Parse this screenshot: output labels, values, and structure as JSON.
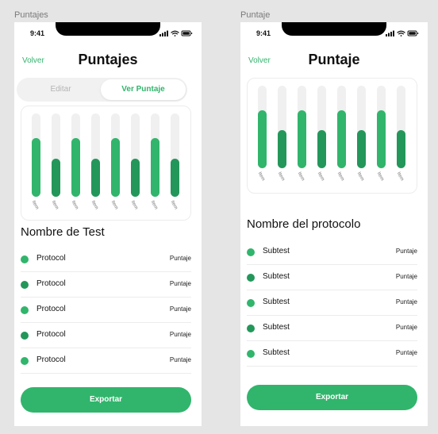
{
  "colors": {
    "accent": "#31b56c",
    "accent_dark": "#23975a",
    "track": "#f0f0f0",
    "canvas": "#e5e5e5"
  },
  "screens": [
    {
      "frame_label": "Puntajes",
      "status_time": "9:41",
      "nav": {
        "back_label": "Volver",
        "title": "Puntajes"
      },
      "segmented": {
        "options": [
          "Editar",
          "Ver Puntaje"
        ],
        "selected": "Ver Puntaje"
      },
      "chart_data": {
        "type": "bar",
        "categories": [
          "Item",
          "Item",
          "Item",
          "Item",
          "Item",
          "Item",
          "Item",
          "Item"
        ],
        "values": [
          0.7,
          0.46,
          0.7,
          0.46,
          0.7,
          0.46,
          0.7,
          0.46
        ],
        "ylim": [
          0,
          1
        ]
      },
      "section_title": "Nombre de Test",
      "rows": [
        {
          "name": "Protocol",
          "score": "Puntaje"
        },
        {
          "name": "Protocol",
          "score": "Puntaje"
        },
        {
          "name": "Protocol",
          "score": "Puntaje"
        },
        {
          "name": "Protocol",
          "score": "Puntaje"
        },
        {
          "name": "Protocol",
          "score": "Puntaje"
        }
      ],
      "export_label": "Exportar"
    },
    {
      "frame_label": "Puntaje",
      "status_time": "9:41",
      "nav": {
        "back_label": "Volver",
        "title": "Puntaje"
      },
      "chart_data": {
        "type": "bar",
        "categories": [
          "Item",
          "Item",
          "Item",
          "Item",
          "Item",
          "Item",
          "Item",
          "Item"
        ],
        "values": [
          0.7,
          0.46,
          0.7,
          0.46,
          0.7,
          0.46,
          0.7,
          0.46
        ],
        "ylim": [
          0,
          1
        ]
      },
      "section_title": "Nombre del protocolo",
      "rows": [
        {
          "name": "Subtest",
          "score": "Puntaje"
        },
        {
          "name": "Subtest",
          "score": "Puntaje"
        },
        {
          "name": "Subtest",
          "score": "Puntaje"
        },
        {
          "name": "Subtest",
          "score": "Puntaje"
        },
        {
          "name": "Subtest",
          "score": "Puntaje"
        }
      ],
      "export_label": "Exportar"
    }
  ]
}
